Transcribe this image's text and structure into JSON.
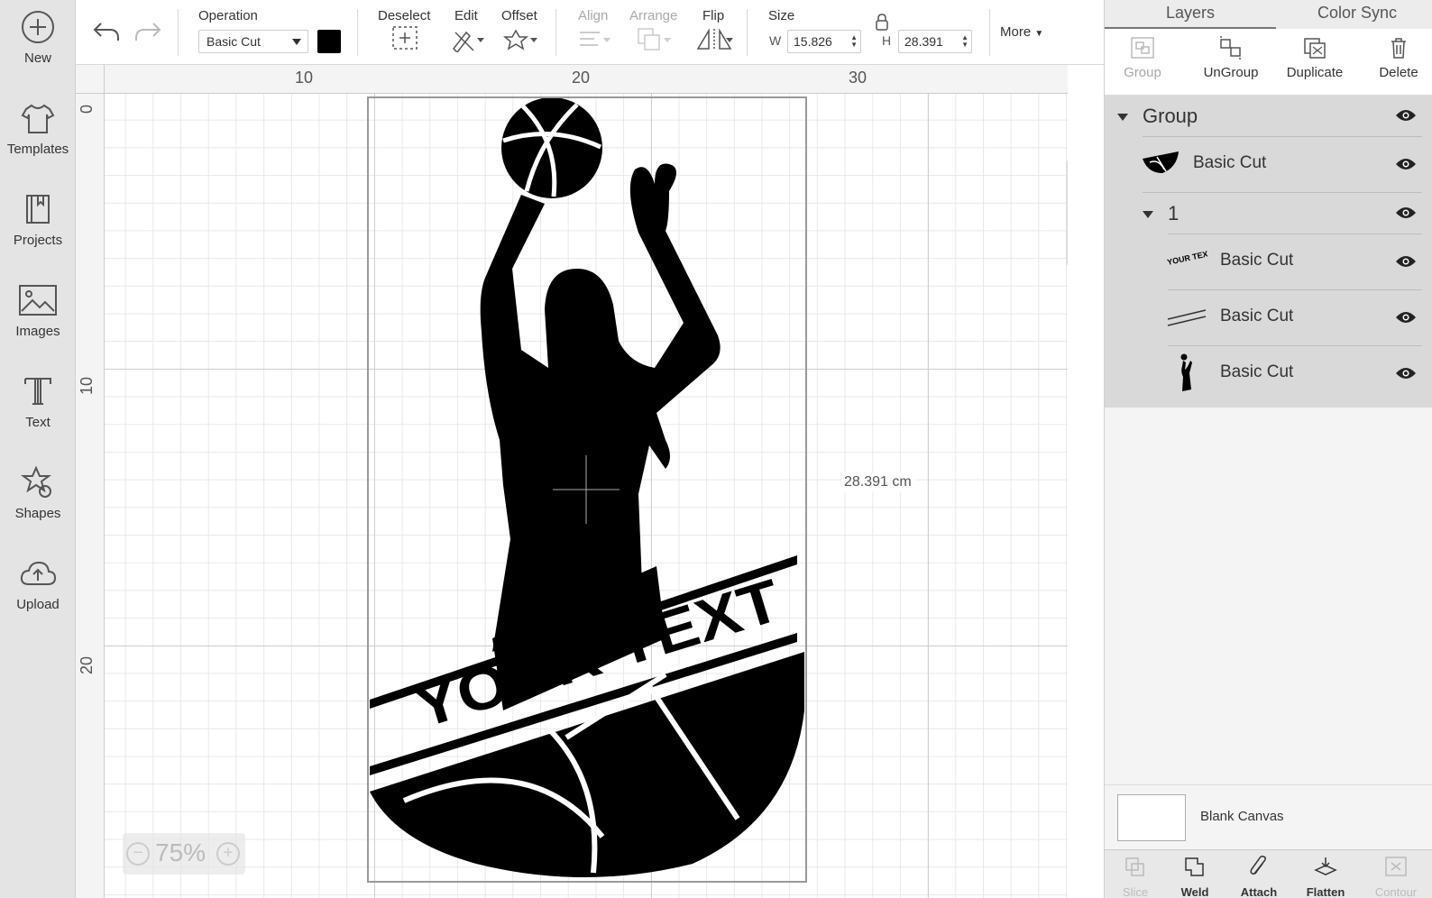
{
  "sidebar": {
    "items": [
      {
        "label": "New",
        "icon": "plus-circle-icon"
      },
      {
        "label": "Templates",
        "icon": "tshirt-icon"
      },
      {
        "label": "Projects",
        "icon": "notebook-icon"
      },
      {
        "label": "Images",
        "icon": "image-icon"
      },
      {
        "label": "Text",
        "icon": "text-icon"
      },
      {
        "label": "Shapes",
        "icon": "shapes-icon"
      },
      {
        "label": "Upload",
        "icon": "upload-cloud-icon"
      }
    ]
  },
  "toolbar": {
    "operation_label": "Operation",
    "operation_value": "Basic Cut",
    "operation_color": "#000000",
    "deselect_label": "Deselect",
    "edit_label": "Edit",
    "offset_label": "Offset",
    "align_label": "Align",
    "arrange_label": "Arrange",
    "flip_label": "Flip",
    "size_label": "Size",
    "w_label": "W",
    "w_value": "15.826",
    "h_label": "H",
    "h_value": "28.391",
    "more_label": "More"
  },
  "canvas": {
    "ruler_top": [
      "10",
      "20",
      "30"
    ],
    "ruler_left": [
      "0",
      "10",
      "20"
    ],
    "dimension_label": "28.391 cm",
    "zoom_minus": "−",
    "zoom_value": "75%",
    "zoom_plus": "+",
    "design_text": "YOUR TEXT"
  },
  "panel": {
    "tabs": [
      "Layers",
      "Color Sync"
    ],
    "actions": [
      {
        "label": "Group",
        "enabled": false
      },
      {
        "label": "UnGroup",
        "enabled": true
      },
      {
        "label": "Duplicate",
        "enabled": true
      },
      {
        "label": "Delete",
        "enabled": true
      }
    ],
    "layers": {
      "group_name": "Group",
      "items": [
        {
          "name": "Basic Cut"
        },
        {
          "name": "1"
        },
        {
          "name": "Basic Cut"
        },
        {
          "name": "Basic Cut"
        },
        {
          "name": "Basic Cut"
        }
      ],
      "thumb_text": "YOUR TEXT"
    },
    "blank_canvas": "Blank Canvas",
    "bottom": [
      {
        "label": "Slice",
        "enabled": false
      },
      {
        "label": "Weld",
        "enabled": true
      },
      {
        "label": "Attach",
        "enabled": true
      },
      {
        "label": "Flatten",
        "enabled": true
      },
      {
        "label": "Contour",
        "enabled": false
      }
    ]
  }
}
